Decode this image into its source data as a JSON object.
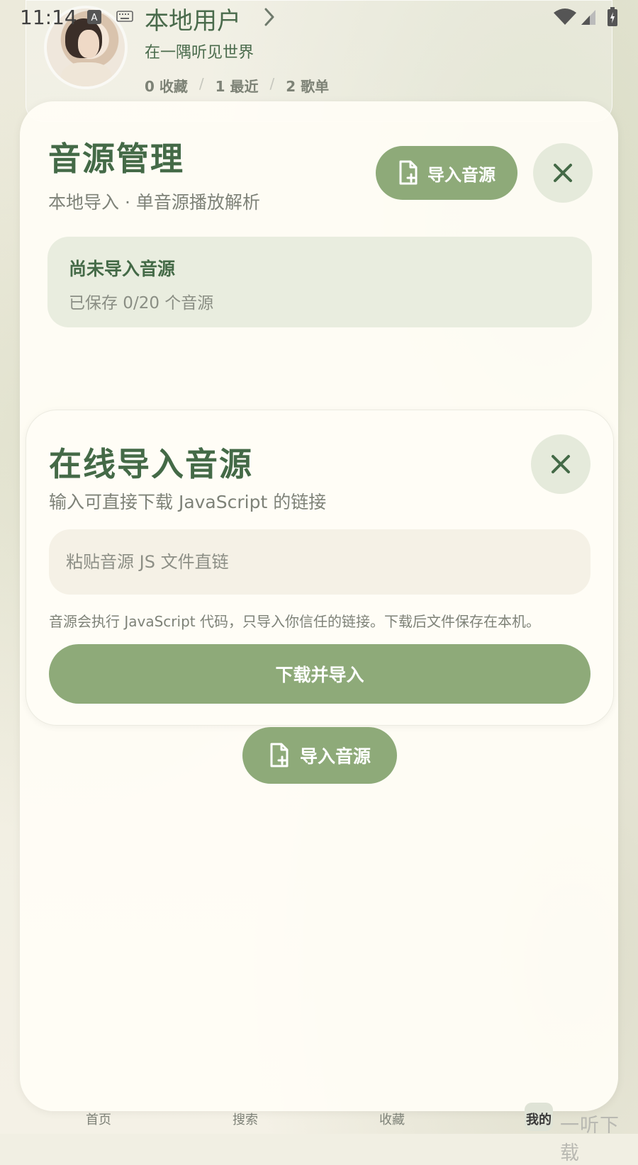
{
  "status_bar": {
    "time": "11:14"
  },
  "profile": {
    "name": "本地用户",
    "bio": "在一隅听见世界",
    "stats": [
      {
        "label": "0 收藏"
      },
      {
        "label": "1 最近"
      },
      {
        "label": "2 歌单"
      }
    ]
  },
  "source_sheet": {
    "title": "音源管理",
    "subtitle": "本地导入 · 单音源播放解析",
    "import_button": "导入音源",
    "status_title": "尚未导入音源",
    "status_count": "已保存 0/20 个音源"
  },
  "online_dialog": {
    "title": "在线导入音源",
    "subtitle": "输入可直接下载 JavaScript 的链接",
    "input_placeholder": "粘贴音源 JS 文件直链",
    "input_value": "",
    "warning": "音源会执行 JavaScript 代码，只导入你信任的链接。下载后文件保存在本机。",
    "submit_button": "下载并导入"
  },
  "floating_import_button": "导入音源",
  "bottom_nav": {
    "items": [
      {
        "label": "首页"
      },
      {
        "label": "搜索"
      },
      {
        "label": "收藏"
      },
      {
        "label": "我的"
      }
    ]
  },
  "watermark": "一听下载",
  "colors": {
    "accent": "#8eaa79",
    "title_green": "#446a47",
    "sheet_bg": "#fffdf6",
    "status_box_bg": "#e9eddf"
  }
}
